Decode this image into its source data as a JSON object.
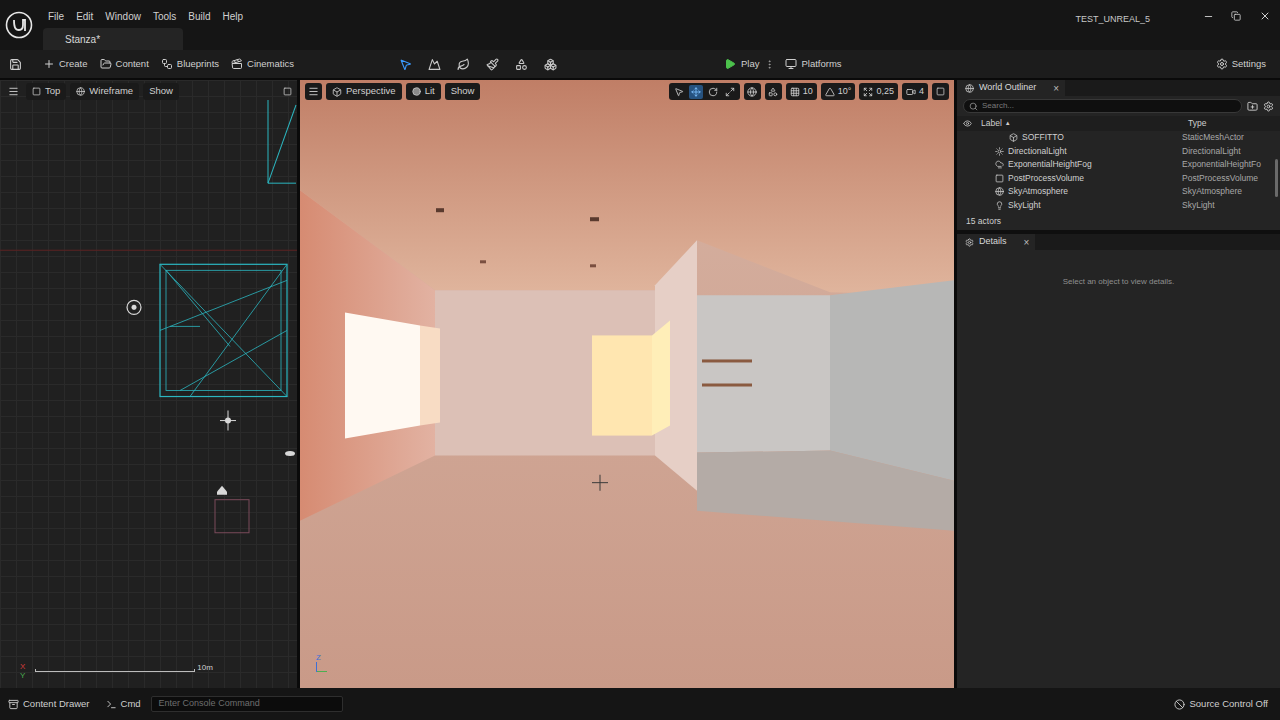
{
  "window": {
    "title": "TEST_UNREAL_5"
  },
  "menu": [
    {
      "label": "File"
    },
    {
      "label": "Edit"
    },
    {
      "label": "Window"
    },
    {
      "label": "Tools"
    },
    {
      "label": "Build"
    },
    {
      "label": "Help"
    }
  ],
  "document_tabs": [
    {
      "label": "Stanza*",
      "selected": true
    }
  ],
  "toolbar": {
    "buttons": [
      {
        "label": "Create",
        "kind": "create"
      },
      {
        "label": "Content",
        "kind": "content"
      },
      {
        "label": "Blueprints",
        "kind": "blueprints"
      },
      {
        "label": "Cinematics",
        "kind": "cinematics"
      }
    ],
    "modes": [
      {
        "kind": "select",
        "selected": true
      },
      {
        "kind": "landscape",
        "selected": false
      },
      {
        "kind": "foliage",
        "selected": false
      },
      {
        "kind": "paint",
        "selected": false
      },
      {
        "kind": "fracture",
        "selected": false
      },
      {
        "kind": "modeling",
        "selected": false
      }
    ],
    "play": "Play",
    "platforms": "Platforms",
    "settings": "Settings"
  },
  "top_viewport": {
    "view": "Top",
    "mode": "Wireframe",
    "show": "Show",
    "scale": "10m",
    "axes": [
      "X",
      "Y"
    ]
  },
  "perspective_viewport": {
    "view": "Perspective",
    "mode": "Lit",
    "show": "Show",
    "transform_tools": [
      {
        "kind": "select",
        "selected": false
      },
      {
        "kind": "move",
        "selected": true
      },
      {
        "kind": "rotate",
        "selected": false
      },
      {
        "kind": "scale",
        "selected": false
      }
    ],
    "snaps": [
      {
        "kind": "grid",
        "label": "10"
      },
      {
        "kind": "angle",
        "label": "10°"
      },
      {
        "kind": "scale",
        "label": "0,25"
      },
      {
        "kind": "camera",
        "label": "4"
      }
    ],
    "axes": [
      "Z"
    ]
  },
  "outliner": {
    "title": "World Outliner",
    "close": "×",
    "search_placeholder": "Search...",
    "columns": [
      {
        "label": "Label",
        "sort": "▲"
      },
      {
        "label": "Type",
        "sort": ""
      }
    ],
    "rows": [
      {
        "label": "SOFFITTO",
        "type": "StaticMeshActor",
        "kind": "mesh",
        "depth": 1,
        "selected": false
      },
      {
        "label": "DirectionalLight",
        "type": "DirectionalLight",
        "kind": "light",
        "depth": 0,
        "selected": false
      },
      {
        "label": "ExponentialHeightFog",
        "type": "ExponentialHeightFo",
        "kind": "fog",
        "depth": 0,
        "selected": false
      },
      {
        "label": "PostProcessVolume",
        "type": "PostProcessVolume",
        "kind": "volume",
        "depth": 0,
        "selected": false
      },
      {
        "label": "SkyAtmosphere",
        "type": "SkyAtmosphere",
        "kind": "atmosphere",
        "depth": 0,
        "selected": false
      },
      {
        "label": "SkyLight",
        "type": "SkyLight",
        "kind": "skylight",
        "depth": 0,
        "selected": false
      }
    ],
    "count": "15 actors"
  },
  "details": {
    "title": "Details",
    "close": "×",
    "empty_message": "Select an object to view details."
  },
  "status_bar": {
    "content_drawer": "Content Drawer",
    "cmd": "Cmd",
    "console_placeholder": "Enter Console Command",
    "source_control": "Source Control Off"
  }
}
